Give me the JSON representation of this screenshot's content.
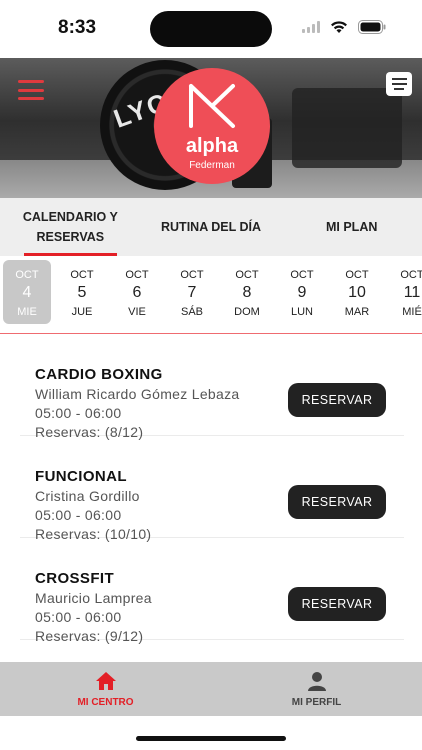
{
  "status_bar": {
    "time": "8:33"
  },
  "header": {
    "logo_name": "alpha",
    "logo_sub": "Federman",
    "background_text": "LYCAN",
    "menu_icon": "hamburger-icon",
    "chat_icon": "chat-icon"
  },
  "tabs": [
    {
      "label": "CALENDARIO Y RESERVAS",
      "active": true
    },
    {
      "label": "RUTINA DEL DÍA",
      "active": false
    },
    {
      "label": "MI PLAN",
      "active": false
    }
  ],
  "days": [
    {
      "month": "OCT",
      "day": "4",
      "weekday": "MIE",
      "selected": true
    },
    {
      "month": "OCT",
      "day": "5",
      "weekday": "JUE"
    },
    {
      "month": "OCT",
      "day": "6",
      "weekday": "VIE"
    },
    {
      "month": "OCT",
      "day": "7",
      "weekday": "SÁB"
    },
    {
      "month": "OCT",
      "day": "8",
      "weekday": "DOM"
    },
    {
      "month": "OCT",
      "day": "9",
      "weekday": "LUN"
    },
    {
      "month": "OCT",
      "day": "10",
      "weekday": "MAR"
    },
    {
      "month": "OCT",
      "day": "11",
      "weekday": "MIÉ"
    }
  ],
  "classes": [
    {
      "name": "CARDIO BOXING",
      "coach": "William Ricardo Gómez Lebaza",
      "time": "05:00 - 06:00",
      "reservations": "Reservas: (8/12)",
      "button": "RESERVAR"
    },
    {
      "name": "FUNCIONAL",
      "coach": "Cristina Gordillo",
      "time": "05:00 - 06:00",
      "reservations": "Reservas: (10/10)",
      "button": "RESERVAR"
    },
    {
      "name": "CROSSFIT",
      "coach": "Mauricio Lamprea",
      "time": "05:00 - 06:00",
      "reservations": "Reservas: (9/12)",
      "button": "RESERVAR"
    }
  ],
  "bottom_nav": [
    {
      "label": "MI CENTRO",
      "icon": "home-icon",
      "active": true
    },
    {
      "label": "MI PERFIL",
      "icon": "user-icon",
      "active": false
    }
  ],
  "colors": {
    "accent": "#e31f26",
    "logo": "#ef4e57",
    "button": "#222222",
    "nav_bg": "#c9c9c9"
  }
}
